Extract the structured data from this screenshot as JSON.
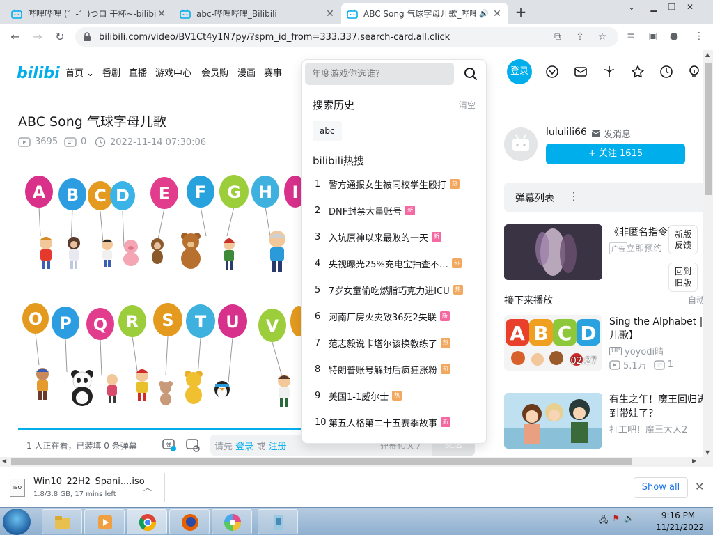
{
  "browser": {
    "tabs": [
      {
        "title": "哔哩哔哩 (゜-゜)つロ 干杯~-bilibili",
        "active": false
      },
      {
        "title": "abc-哔哩哔哩_Bilibili",
        "active": false
      },
      {
        "title": "ABC Song 气球字母儿歌_哔哩",
        "active": true
      }
    ],
    "url": "bilibili.com/video/BV1Ct4y1N7py/?spm_id_from=333.337.search-card.all.click"
  },
  "header": {
    "nav": [
      "首页",
      "番剧",
      "直播",
      "游戏中心",
      "会员购",
      "漫画",
      "赛事"
    ],
    "login": "登录"
  },
  "search": {
    "placeholder": "年度游戏你选谁？",
    "history_title": "搜索历史",
    "clear": "清空",
    "history": [
      "abc"
    ],
    "hot_title": "bilibili热搜",
    "hot": [
      {
        "rank": "1",
        "text": "警方通报女生被同校学生殴打",
        "badge": "热",
        "type": "hot"
      },
      {
        "rank": "2",
        "text": "DNF封禁大量账号",
        "badge": "新",
        "type": "new"
      },
      {
        "rank": "3",
        "text": "入坑原神以来最败的一天",
        "badge": "新",
        "type": "new"
      },
      {
        "rank": "4",
        "text": "央视曝光25%充电宝抽查不…",
        "badge": "热",
        "type": "hot"
      },
      {
        "rank": "5",
        "text": "7岁女童偷吃燃脂巧克力进ICU",
        "badge": "热",
        "type": "hot"
      },
      {
        "rank": "6",
        "text": "河南厂房火灾致36死2失联",
        "badge": "新",
        "type": "new"
      },
      {
        "rank": "7",
        "text": "范志毅说卡塔尔该换教练了",
        "badge": "热",
        "type": "hot"
      },
      {
        "rank": "8",
        "text": "特朗普账号解封后疯狂涨粉",
        "badge": "热",
        "type": "hot"
      },
      {
        "rank": "9",
        "text": "美国1-1威尔士",
        "badge": "热",
        "type": "hot"
      },
      {
        "rank": "10",
        "text": "第五人格第二十五赛季故事",
        "badge": "新",
        "type": "new"
      }
    ]
  },
  "video": {
    "title": "ABC Song 气球字母儿歌",
    "views": "3695",
    "danmaku": "0",
    "date": "2022-11-14 07:30:06",
    "watching": "1 人正在看，已装填 0 条弹幕",
    "login_prompt_a": "请先",
    "login_link": "登录",
    "login_or": "或",
    "register_link": "注册",
    "etiquette": "弹幕礼仪",
    "send": "发送"
  },
  "uploader": {
    "name": "lulul​ili66",
    "message": "发消息",
    "follow": "+ 关注 1615"
  },
  "sidebar": {
    "danmu_list": "弹幕列表",
    "ad": {
      "title": "《非匿名指令》",
      "tag": "广告",
      "sub": "立即预约"
    },
    "new_feedback": [
      "新版",
      "反馈"
    ],
    "back_old": [
      "回到",
      "旧版"
    ],
    "next_title": "接下来播放",
    "autoplay": "自动",
    "recs": [
      {
        "title": "Sing the Alphabet | 儿歌】",
        "up": "yoyodi晴",
        "views": "5.1万",
        "danmaku": "1",
        "duration": "02:27"
      },
      {
        "title": "有生之年！魔王回归进到带娃了？",
        "up": "打工吧！魔王大人2",
        "views": "",
        "danmaku": "",
        "duration": ""
      }
    ]
  },
  "download": {
    "name": "Win10_22H2_Spani....iso",
    "status": "1.8/3.8 GB, 17 mins left",
    "show_all": "Show all"
  },
  "taskbar": {
    "time": "9:16 PM",
    "date": "11/21/2022"
  },
  "colors": {
    "accent": "#00aeec",
    "hot": "#f2a95f",
    "new": "#f569a3"
  }
}
